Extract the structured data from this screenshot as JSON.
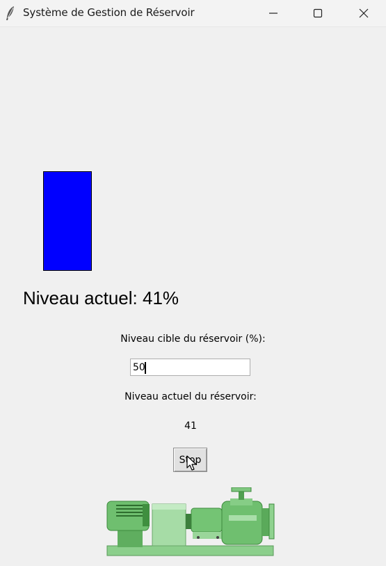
{
  "window": {
    "title": "Système de Gestion de Réservoir"
  },
  "tank": {
    "fill_color": "#0000ff",
    "level_percent": 41
  },
  "level_display": {
    "text": "Niveau actuel: 41%"
  },
  "form": {
    "target_label": "Niveau cible du réservoir (%):",
    "target_value": "50",
    "current_label": "Niveau actuel du réservoir:",
    "current_value": "41",
    "stop_label": "Stop"
  },
  "icons": {
    "app": "feather-icon",
    "minimize": "minimize-icon",
    "maximize": "maximize-icon",
    "close": "close-icon",
    "pump": "pump-image",
    "cursor": "mouse-pointer-cursor"
  },
  "colors": {
    "pump_green": "#6fbf6f",
    "background": "#f0f0f0"
  }
}
